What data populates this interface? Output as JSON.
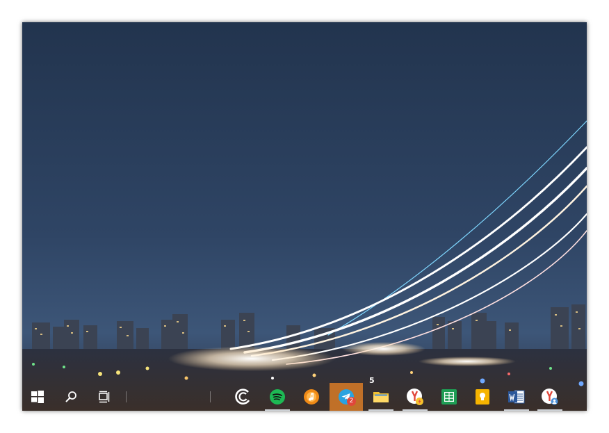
{
  "desktop": {
    "wallpaper": "night-runway-light-trails"
  },
  "taskbar": {
    "accent_color": "#c07028",
    "items": [
      {
        "name": "start",
        "icon": "windows-icon"
      },
      {
        "name": "search",
        "icon": "search-icon"
      },
      {
        "name": "task-view",
        "icon": "task-view-icon"
      },
      {
        "name": "app-ring",
        "icon": "ring-app-icon"
      },
      {
        "name": "spotify",
        "icon": "spotify-icon"
      },
      {
        "name": "music",
        "icon": "music-player-icon"
      },
      {
        "name": "telegram",
        "icon": "telegram-icon",
        "badge": "2",
        "active": true
      },
      {
        "name": "file-explorer",
        "icon": "folder-icon",
        "label": "5"
      },
      {
        "name": "yandex-browser-1",
        "icon": "yandex-browser-icon"
      },
      {
        "name": "google-sheets",
        "icon": "sheets-icon"
      },
      {
        "name": "google-keep",
        "icon": "keep-icon"
      },
      {
        "name": "word",
        "icon": "word-icon"
      },
      {
        "name": "yandex-browser-2",
        "icon": "yandex-browser-icon"
      }
    ]
  }
}
